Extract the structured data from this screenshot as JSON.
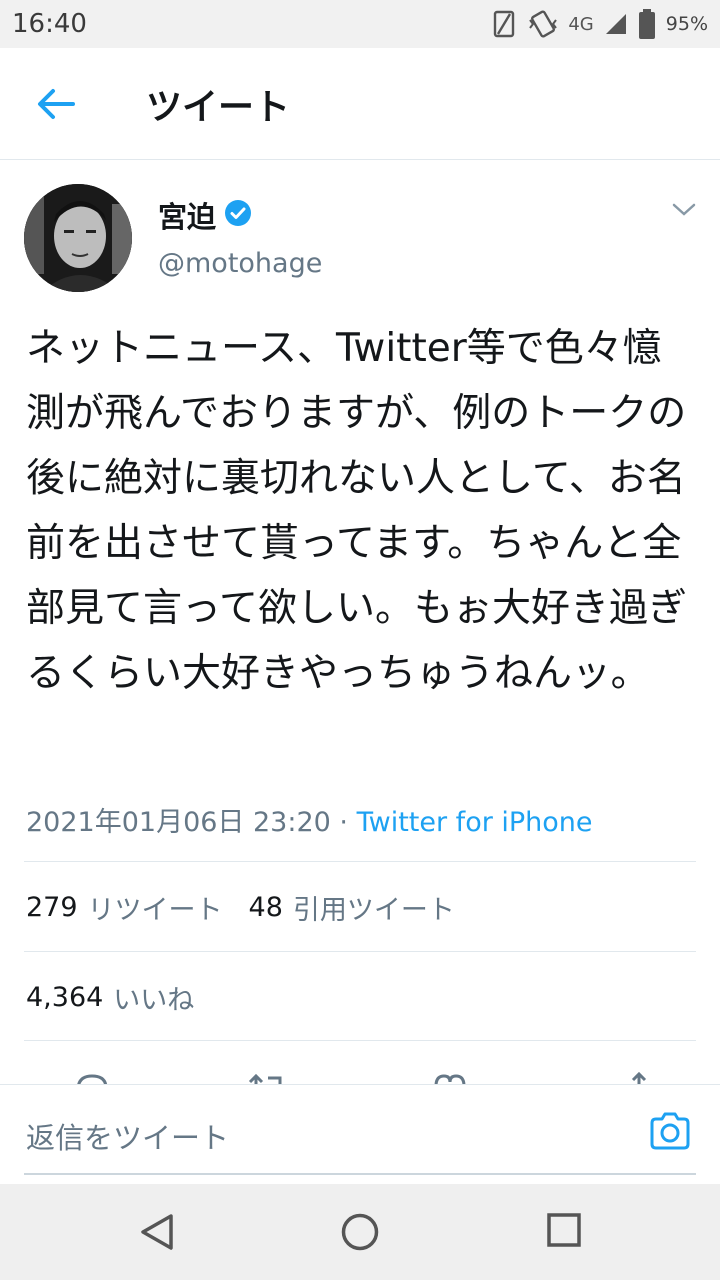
{
  "status_bar": {
    "time": "16:40",
    "network": "4G",
    "battery": "95%"
  },
  "header": {
    "title": "ツイート",
    "back_icon": "arrow-left-icon"
  },
  "tweet": {
    "author": {
      "name": "宮迫",
      "handle": "@motohage",
      "verified": true
    },
    "text": "ネットニュース、Twitter等で色々憶測が飛んでおりますが、例のトークの後に絶対に裏切れない人として、お名前を出させて貰ってます。ちゃんと全部見て言って欲しい。もぉ大好き過ぎるくらい大好きやっちゅうねんッ。",
    "timestamp": "2021年01月06日 23:20",
    "separator": "·",
    "source": "Twitter for iPhone"
  },
  "stats": {
    "retweets": {
      "count": "279",
      "label": "リツイート"
    },
    "quotes": {
      "count": "48",
      "label": "引用ツイート"
    },
    "likes": {
      "count": "4,364",
      "label": "いいね"
    }
  },
  "reply": {
    "placeholder": "返信をツイート"
  },
  "colors": {
    "accent": "#1da1f2",
    "secondary_text": "#657786",
    "divider": "#e1e8ed"
  }
}
